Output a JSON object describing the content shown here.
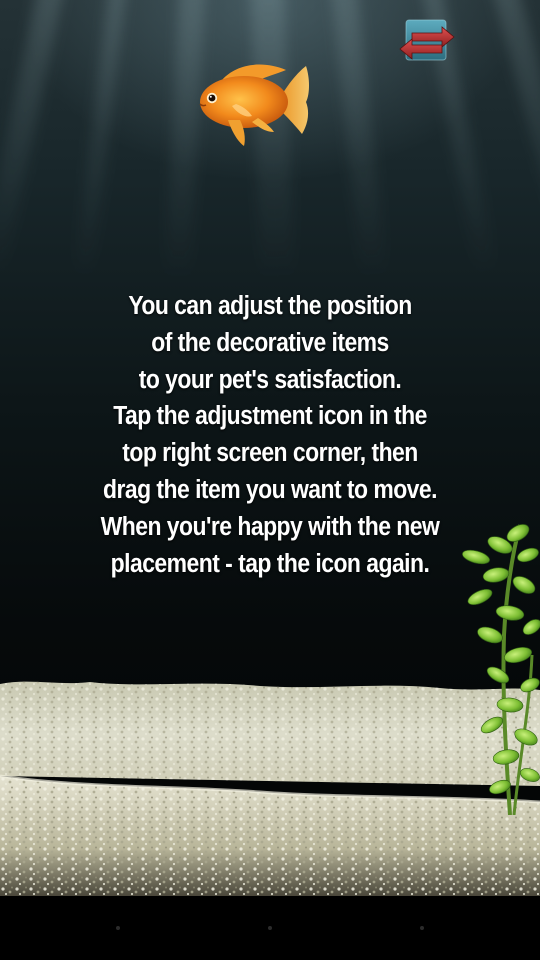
{
  "instructions": {
    "lines": [
      "You can adjust the position",
      "of the decorative items",
      "to your pet's satisfaction.",
      "Tap the adjustment icon in the",
      "top right screen corner, then",
      "drag the item you want to move.",
      "When you're happy with the new",
      "placement - tap the icon again."
    ]
  },
  "icons": {
    "adjust": "swap-arrows-icon",
    "fish": "goldfish",
    "plant": "aquatic-plant"
  },
  "colors": {
    "water_top": "#243236",
    "water_bottom": "#020303",
    "gravel": "#d9d8c4",
    "fish": "#f08a1e",
    "plant": "#7fc23a",
    "adjust_arrow": "#c23a3a",
    "adjust_tile": "#3d8a9e"
  }
}
